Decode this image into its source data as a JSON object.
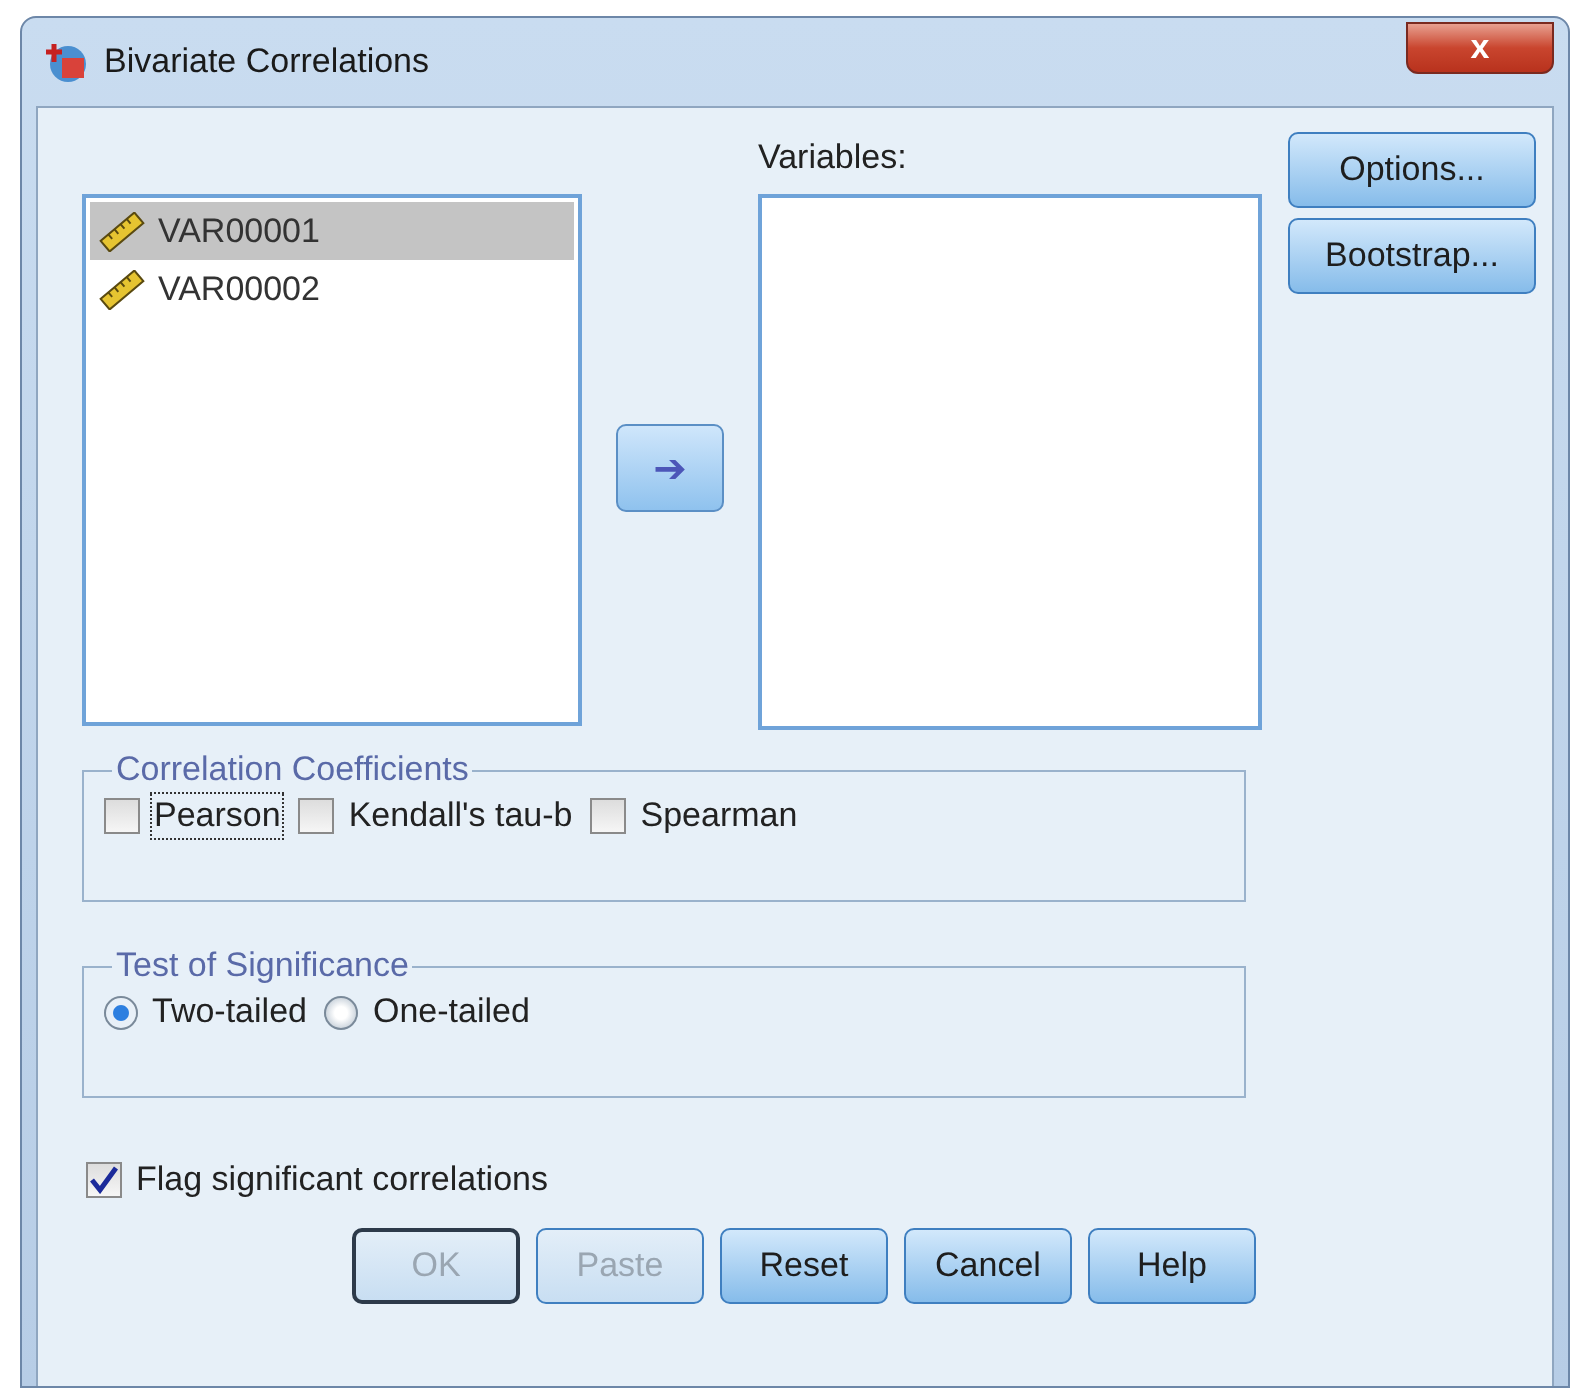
{
  "window": {
    "title": "Bivariate Correlations",
    "close": "x"
  },
  "source_list": {
    "items": [
      {
        "label": "VAR00001",
        "selected": true
      },
      {
        "label": "VAR00002",
        "selected": false
      }
    ]
  },
  "move_button": {
    "label": "➔"
  },
  "variables": {
    "label": "Variables:"
  },
  "side_buttons": [
    "Options...",
    "Bootstrap..."
  ],
  "coefficients": {
    "title": "Correlation Coefficients",
    "options": [
      {
        "label": "Pearson",
        "checked": false,
        "focused": true
      },
      {
        "label": "Kendall's tau-b",
        "checked": false,
        "focused": false
      },
      {
        "label": "Spearman",
        "checked": false,
        "focused": false
      }
    ]
  },
  "significance": {
    "title": "Test of Significance",
    "options": [
      {
        "label": "Two-tailed",
        "selected": true
      },
      {
        "label": "One-tailed",
        "selected": false
      }
    ]
  },
  "flag": {
    "label": "Flag significant correlations",
    "checked": true
  },
  "buttons": [
    {
      "label": "OK",
      "disabled": true,
      "default": true
    },
    {
      "label": "Paste",
      "disabled": true,
      "default": false
    },
    {
      "label": "Reset",
      "disabled": false,
      "default": false
    },
    {
      "label": "Cancel",
      "disabled": false,
      "default": false
    },
    {
      "label": "Help",
      "disabled": false,
      "default": false
    }
  ]
}
